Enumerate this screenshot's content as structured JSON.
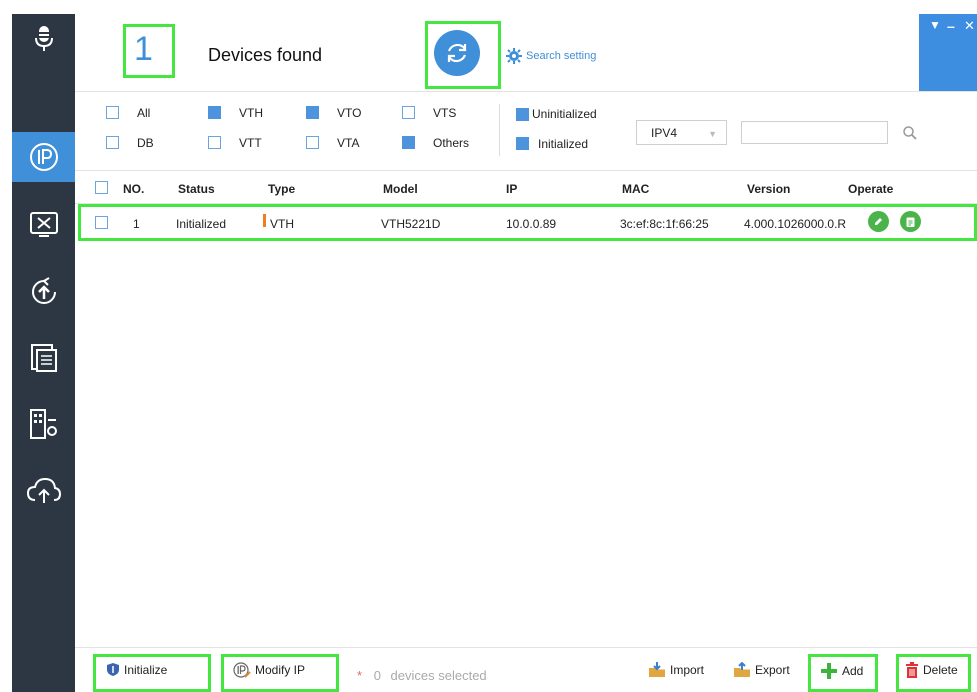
{
  "header": {
    "device_count": "1",
    "devices_found_label": "Devices found",
    "search_setting_label": "Search setting"
  },
  "filters": {
    "types": [
      {
        "label": "All",
        "checked": false
      },
      {
        "label": "VTH",
        "checked": true
      },
      {
        "label": "VTO",
        "checked": true
      },
      {
        "label": "VTS",
        "checked": false
      },
      {
        "label": "DB",
        "checked": false
      },
      {
        "label": "VTT",
        "checked": false
      },
      {
        "label": "VTA",
        "checked": false
      },
      {
        "label": "Others",
        "checked": true
      }
    ],
    "states": [
      {
        "label": "Uninitialized",
        "checked": true
      },
      {
        "label": "Initialized",
        "checked": true
      }
    ],
    "ip_version": "IPV4",
    "search_value": ""
  },
  "table": {
    "columns": [
      "NO.",
      "Status",
      "Type",
      "Model",
      "IP",
      "MAC",
      "Version",
      "Operate"
    ],
    "rows": [
      {
        "no": "1",
        "status": "Initialized",
        "type": "VTH",
        "model": "VTH5221D",
        "ip": "10.0.0.89",
        "mac": "3c:ef:8c:1f:66:25",
        "version": "4.000.1026000.0.R"
      }
    ]
  },
  "bottom": {
    "initialize_label": "Initialize",
    "modify_ip_label": "Modify IP",
    "selected_count": "0",
    "selected_text": "devices selected",
    "import_label": "Import",
    "export_label": "Export",
    "add_label": "Add",
    "delete_label": "Delete"
  },
  "colors": {
    "accent": "#3f8fd9",
    "sidebar": "#2d3743",
    "highlight": "#46e640",
    "type_marker": "#f07d1f",
    "operate_buttons": "#4ab34a"
  }
}
